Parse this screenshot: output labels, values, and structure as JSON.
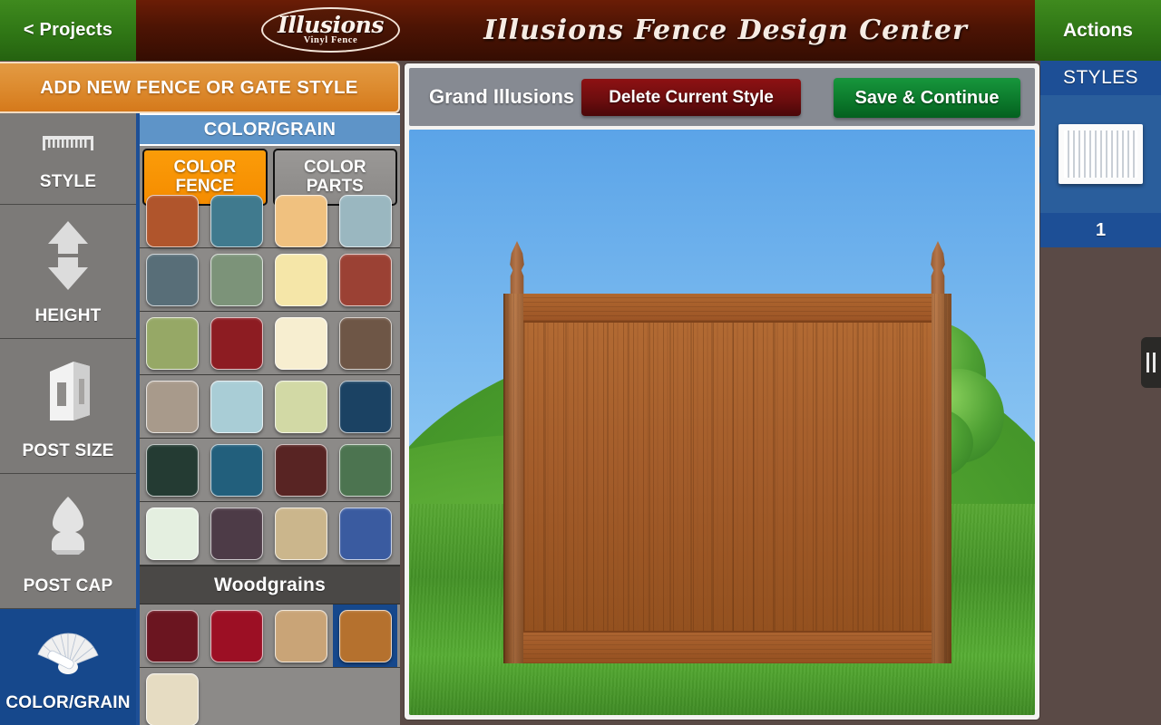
{
  "header": {
    "projects_label": "< Projects",
    "brand_name": "Illusions",
    "brand_tagline": "Vinyl Fence",
    "title": "Illusions Fence Design Center",
    "actions_label": "Actions"
  },
  "add_style_button": {
    "label": "ADD NEW FENCE OR GATE STYLE"
  },
  "sidebar": {
    "items": [
      {
        "label": "STYLE",
        "icon": "fence-panel-icon",
        "active": false
      },
      {
        "label": "HEIGHT",
        "icon": "up-down-arrows-icon",
        "active": false
      },
      {
        "label": "POST SIZE",
        "icon": "post-box-icon",
        "active": false
      },
      {
        "label": "POST CAP",
        "icon": "post-cap-icon",
        "active": false
      },
      {
        "label": "COLOR/GRAIN",
        "icon": "color-fan-icon",
        "active": true
      }
    ]
  },
  "color_panel": {
    "title": "COLOR/GRAIN",
    "tabs": [
      {
        "label_line1": "COLOR",
        "label_line2": "FENCE",
        "selected": true
      },
      {
        "label_line1": "COLOR",
        "label_line2": "PARTS",
        "selected": false
      }
    ],
    "solid_rows": [
      [
        "#b0552c",
        "#407a8e",
        "#f0c17f",
        "#9ab7c0"
      ],
      [
        "#586e78",
        "#7c9379",
        "#f5e6a8",
        "#9b4134"
      ],
      [
        "#96a866",
        "#8d1c22",
        "#f7eed0",
        "#6e5646"
      ],
      [
        "#a89a8b",
        "#a9cdd6",
        "#d2d9a5",
        "#1b4263"
      ],
      [
        "#243b33",
        "#225f7c",
        "#582423",
        "#4c7450"
      ],
      [
        "#e4efe0",
        "#4d3b47",
        "#cbb68c",
        "#3a5ba0"
      ]
    ],
    "woodgrain_header": "Woodgrains",
    "woodgrain_rows": [
      [
        {
          "color": "#6b1520",
          "selected": false
        },
        {
          "color": "#9c0f24",
          "selected": false
        },
        {
          "color": "#c9a477",
          "selected": false
        },
        {
          "color": "#b5712e",
          "selected": true
        }
      ],
      [
        {
          "color": "#e6dcc2",
          "selected": false
        }
      ]
    ]
  },
  "main_panel": {
    "style_name": "Grand Illusions",
    "delete_label": "Delete Current Style",
    "save_label": "Save & Continue"
  },
  "styles_rail": {
    "title": "STYLES",
    "items": [
      {
        "number": "1",
        "thumbnail": "white-picket-fence-thumb"
      }
    ]
  }
}
